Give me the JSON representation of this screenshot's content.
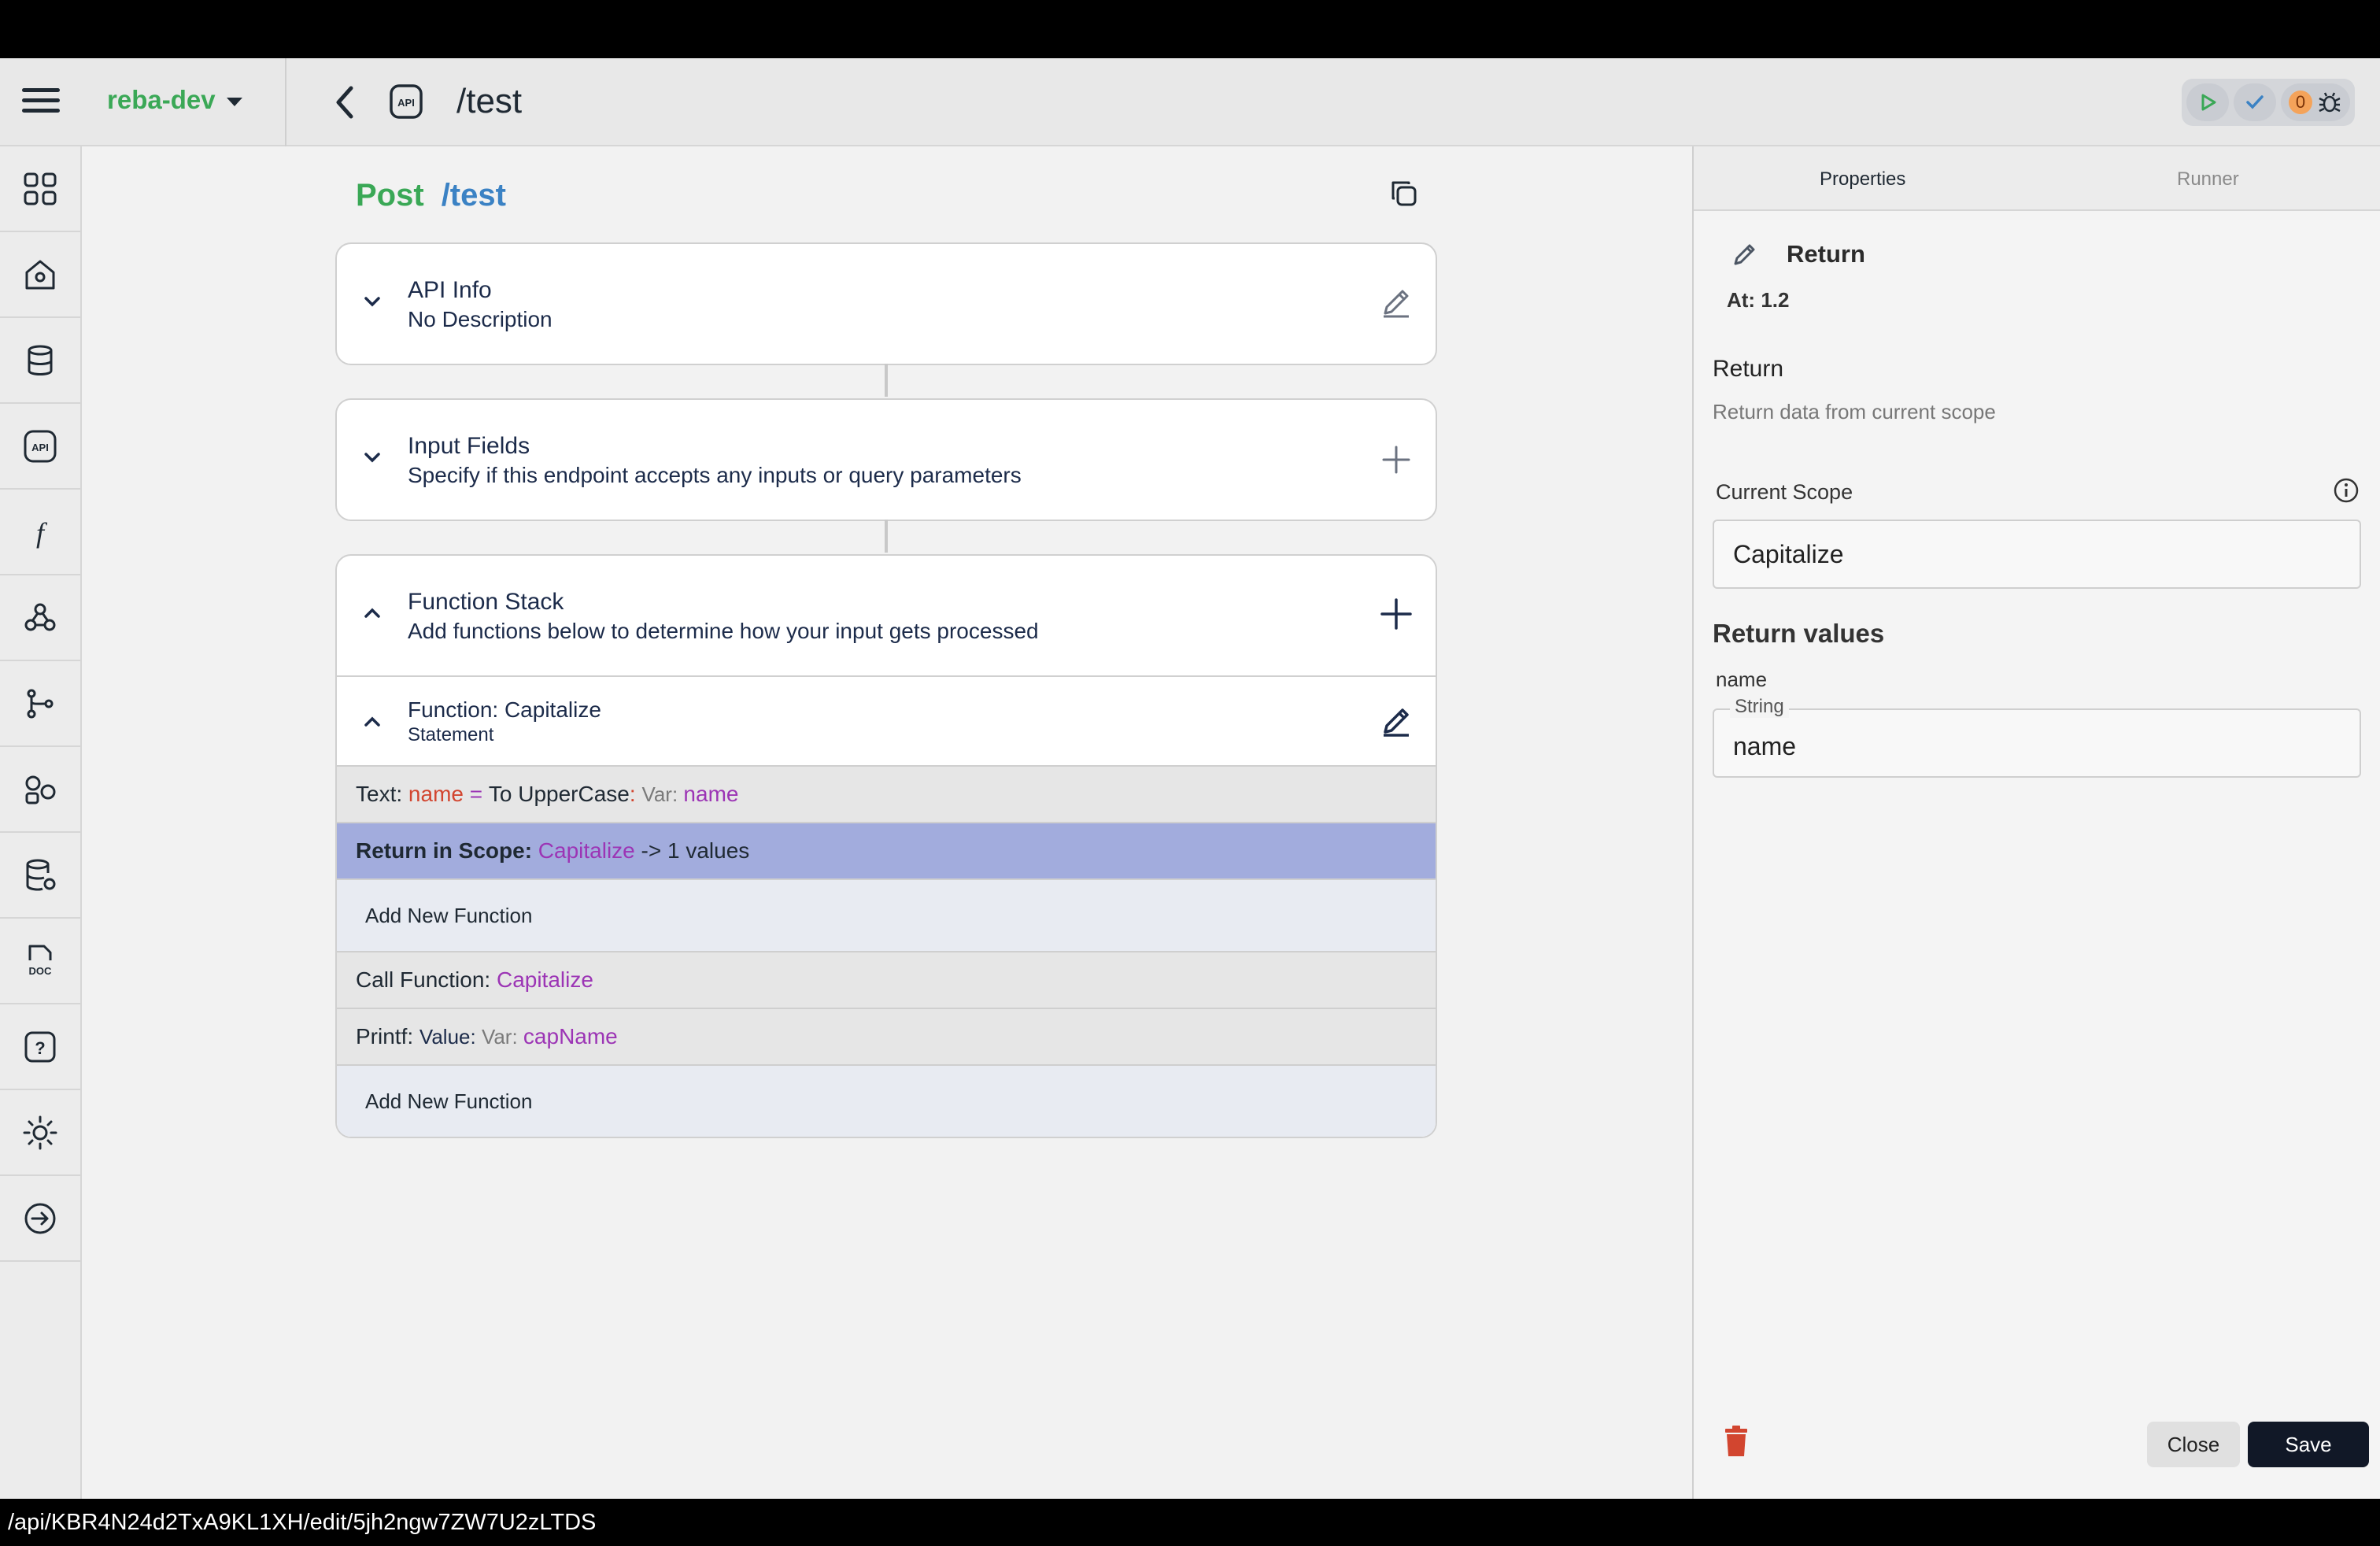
{
  "header": {
    "workspace": "reba-dev",
    "title": "/test"
  },
  "header_actions": {
    "issue_count": "0"
  },
  "sidebar": {
    "items": [
      {
        "icon": "dashboard-grid-icon"
      },
      {
        "icon": "home-icon"
      },
      {
        "icon": "database-icon"
      },
      {
        "icon": "api-icon"
      },
      {
        "icon": "function-icon"
      },
      {
        "icon": "webhook-icon"
      },
      {
        "icon": "branch-icon"
      },
      {
        "icon": "addons-icon"
      },
      {
        "icon": "database-settings-icon"
      },
      {
        "icon": "doc-icon"
      },
      {
        "icon": "help-icon"
      },
      {
        "icon": "theme-icon"
      },
      {
        "icon": "logout-icon"
      }
    ]
  },
  "endpoint": {
    "method": "Post",
    "path": "/test"
  },
  "api_info": {
    "title": "API Info",
    "description": "No Description"
  },
  "input_fields": {
    "title": "Input Fields",
    "description": "Specify if this endpoint accepts any inputs or query parameters"
  },
  "function_stack": {
    "title": "Function Stack",
    "description": "Add functions below to determine how your input gets processed",
    "function": {
      "title": "Function: Capitalize",
      "subtitle": "Statement",
      "stmt1": {
        "prefix": "Text: ",
        "var": "name",
        "eq": " = ",
        "op": "To UpperCase",
        "colon": ": ",
        "var_label": "Var: ",
        "var_value": "name"
      },
      "stmt2": {
        "prefix": "Return in Scope: ",
        "scope": "Capitalize",
        "suffix": " -> 1 values"
      },
      "add_label": "Add New Function"
    },
    "stmt3": {
      "prefix": "Call Function: ",
      "value": "Capitalize"
    },
    "stmt4": {
      "prefix": "Printf: ",
      "value_label": "Value: ",
      "var_label": "Var: ",
      "var_value": "capName"
    },
    "add_label": "Add New Function"
  },
  "panel": {
    "tabs": [
      "Properties",
      "Runner"
    ],
    "title": "Return",
    "at": "At: 1.2",
    "section_title": "Return",
    "description": "Return data from current scope",
    "scope_label": "Current Scope",
    "scope_value": "Capitalize",
    "return_values_title": "Return values",
    "field_name": "name",
    "field_type": "String",
    "field_value": "name",
    "close_label": "Close",
    "save_label": "Save"
  },
  "statusbar": {
    "url": "/api/KBR4N24d2TxA9KL1XH/edit/5jh2ngw7ZW7U2zLTDS"
  },
  "colors": {
    "method_green": "#3aa856",
    "path_blue": "#3b82c4",
    "selected_row": "#a2acdd",
    "var_red": "#d2452f",
    "value_purple": "#9c35b5",
    "save_button": "#111827"
  }
}
